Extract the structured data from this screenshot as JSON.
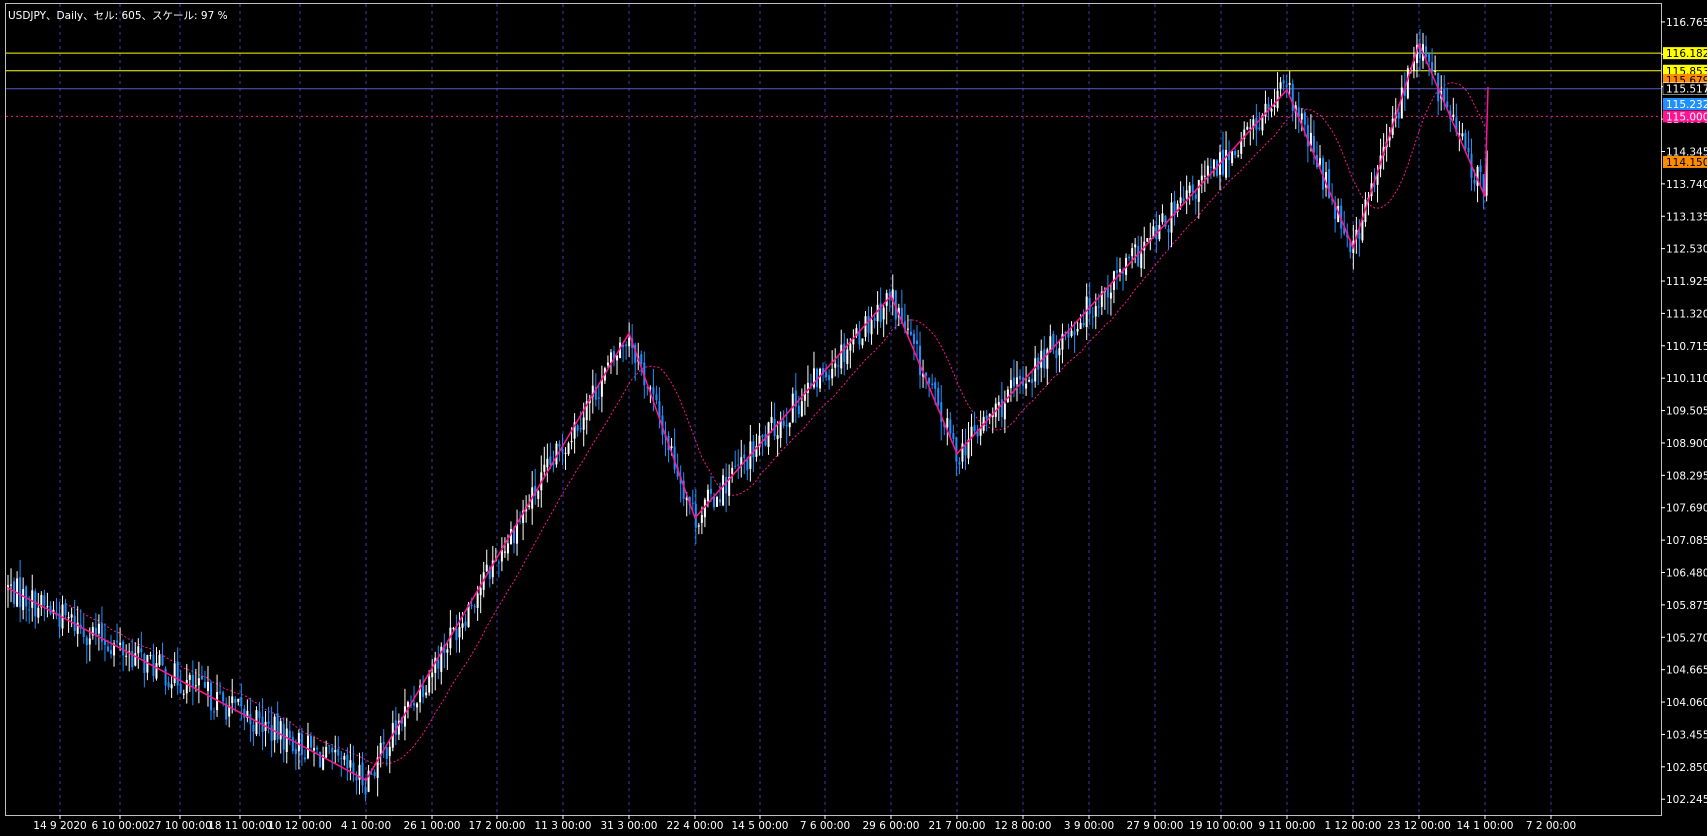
{
  "header": {
    "title": "USDJPY、Daily、セル: 605、スケール: 97 %"
  },
  "chart_data": {
    "type": "candlestick",
    "title": "USDJPY、Daily、セル: 605、スケール: 97 %",
    "ylim": [
      101.95,
      117.1
    ],
    "y_ticks": [
      "116.765",
      "116.160",
      "115.555",
      "114.950",
      "114.345",
      "113.740",
      "113.135",
      "112.530",
      "111.925",
      "111.320",
      "110.715",
      "110.110",
      "109.505",
      "108.900",
      "108.295",
      "107.690",
      "107.085",
      "106.480",
      "105.875",
      "105.270",
      "104.665",
      "104.060",
      "103.455",
      "102.850",
      "102.245"
    ],
    "x_ticks": [
      "14 9 2020",
      "6 10 00:00",
      "27 10 00:00",
      "18 11 00:00",
      "10 12 00:00",
      "4 1 00:00",
      "26 1 00:00",
      "17 2 00:00",
      "11 3 00:00",
      "31 3 00:00",
      "22 4 00:00",
      "14 5 00:00",
      "7 6 00:00",
      "29 6 00:00",
      "21 7 00:00",
      "12 8 00:00",
      "3 9 00:00",
      "27 9 00:00",
      "19 10 00:00",
      "9 11 00:00",
      "1 12 00:00",
      "23 12 00:00",
      "14 1 00:00",
      "7 2 00:00"
    ],
    "grid": true,
    "horizontal_lines": [
      {
        "price": 116.182,
        "label": "116.182",
        "color": "#ffff00",
        "style": "solid"
      },
      {
        "price": 115.853,
        "label": "115.853",
        "color": "#ffff00",
        "style": "solid"
      },
      {
        "price": 115.517,
        "label": "115.517",
        "color": "#5a5ac8",
        "style": "solid"
      },
      {
        "price": 115.0,
        "label": "115.000",
        "color": "#ff1493",
        "style": "dotted"
      }
    ],
    "price_labels": [
      {
        "price": 116.182,
        "label": "116.182",
        "bg": "#ffff00",
        "fg": "#000000"
      },
      {
        "price": 115.853,
        "label": "115.853",
        "bg": "#ffff00",
        "fg": "#000000"
      },
      {
        "price": 115.679,
        "label": "115.679",
        "bg": "#ff8c00",
        "fg": "#000000"
      },
      {
        "price": 115.517,
        "label": "115.517",
        "bg": "#000000",
        "fg": "#ffffff"
      },
      {
        "price": 115.232,
        "label": "115.232",
        "bg": "#1e90ff",
        "fg": "#ffffff"
      },
      {
        "price": 115.0,
        "label": "115.000",
        "bg": "#ff1493",
        "fg": "#ffffff"
      },
      {
        "price": 114.15,
        "label": "114.150",
        "bg": "#ff8c00",
        "fg": "#000000"
      }
    ],
    "zigzag": [
      {
        "x": "14 9 2020",
        "y": 106.2
      },
      {
        "x": "4 1 00:00",
        "y": 102.6
      },
      {
        "x": "31 3 00:00",
        "y": 110.95
      },
      {
        "x": "22 4 00:00",
        "y": 107.5
      },
      {
        "x": "29 6 00:00",
        "y": 111.65
      },
      {
        "x": "21 7 00:00",
        "y": 108.7
      },
      {
        "x": "9 11 00:00",
        "y": 115.5
      },
      {
        "x": "1 12 00:00",
        "y": 112.55
      },
      {
        "x": "23 12 00:00",
        "y": 116.35
      },
      {
        "x": "14 1 00:00",
        "y": 113.5
      },
      {
        "x": "7 2 00:00",
        "y": 115.55
      }
    ],
    "ma_color": "#ff1493",
    "up_color": "#ffffff",
    "down_color": "#1e90ff",
    "zigzag_color": "#ff1493",
    "grid_color": "#3a3ab4",
    "axis_color": "#ffffff"
  }
}
